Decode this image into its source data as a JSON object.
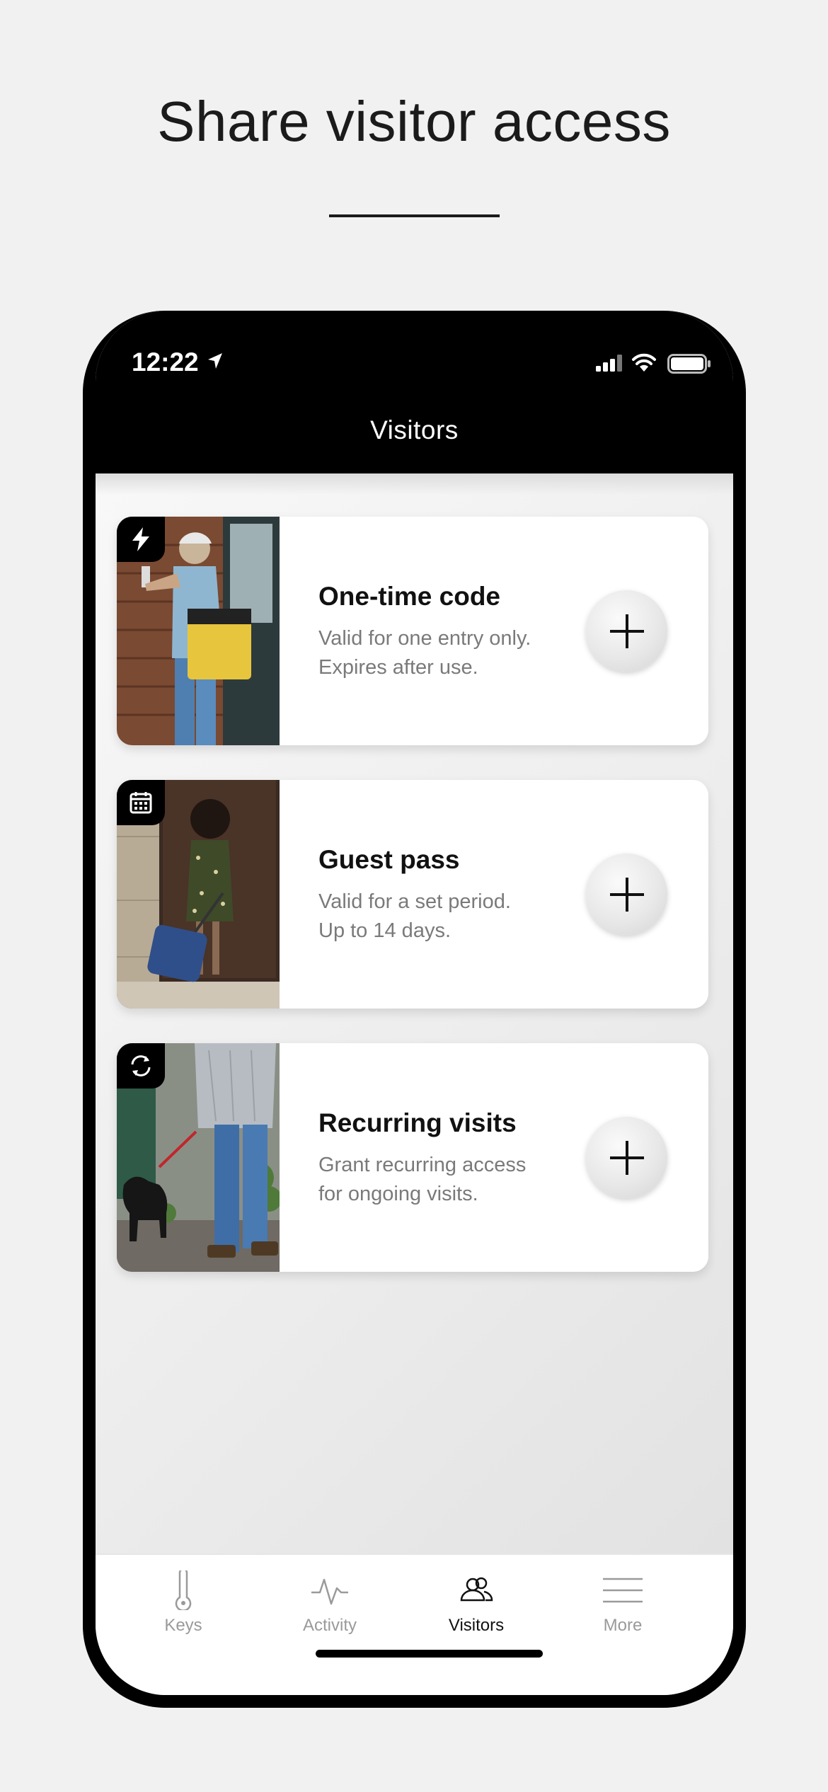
{
  "page": {
    "headline": "Share visitor access"
  },
  "status_bar": {
    "time": "12:22",
    "icons": [
      "location-arrow-icon",
      "cellular-signal-icon",
      "wifi-icon",
      "battery-icon"
    ]
  },
  "nav": {
    "title": "Visitors"
  },
  "cards": [
    {
      "badge_icon": "lightning-icon",
      "title": "One-time code",
      "desc_line1": "Valid for one entry only.",
      "desc_line2": "Expires after use.",
      "button_icon": "plus-icon"
    },
    {
      "badge_icon": "calendar-icon",
      "title": "Guest pass",
      "desc_line1": "Valid for a set period.",
      "desc_line2": "Up to 14 days.",
      "button_icon": "plus-icon"
    },
    {
      "badge_icon": "refresh-icon",
      "title": "Recurring visits",
      "desc_line1": "Grant recurring access",
      "desc_line2": "for ongoing visits.",
      "button_icon": "plus-icon"
    }
  ],
  "tabbar": {
    "active": "Visitors",
    "tabs": [
      {
        "label": "Keys",
        "icon": "key-icon"
      },
      {
        "label": "Activity",
        "icon": "activity-icon"
      },
      {
        "label": "Visitors",
        "icon": "visitors-icon"
      },
      {
        "label": "More",
        "icon": "menu-icon"
      }
    ]
  }
}
